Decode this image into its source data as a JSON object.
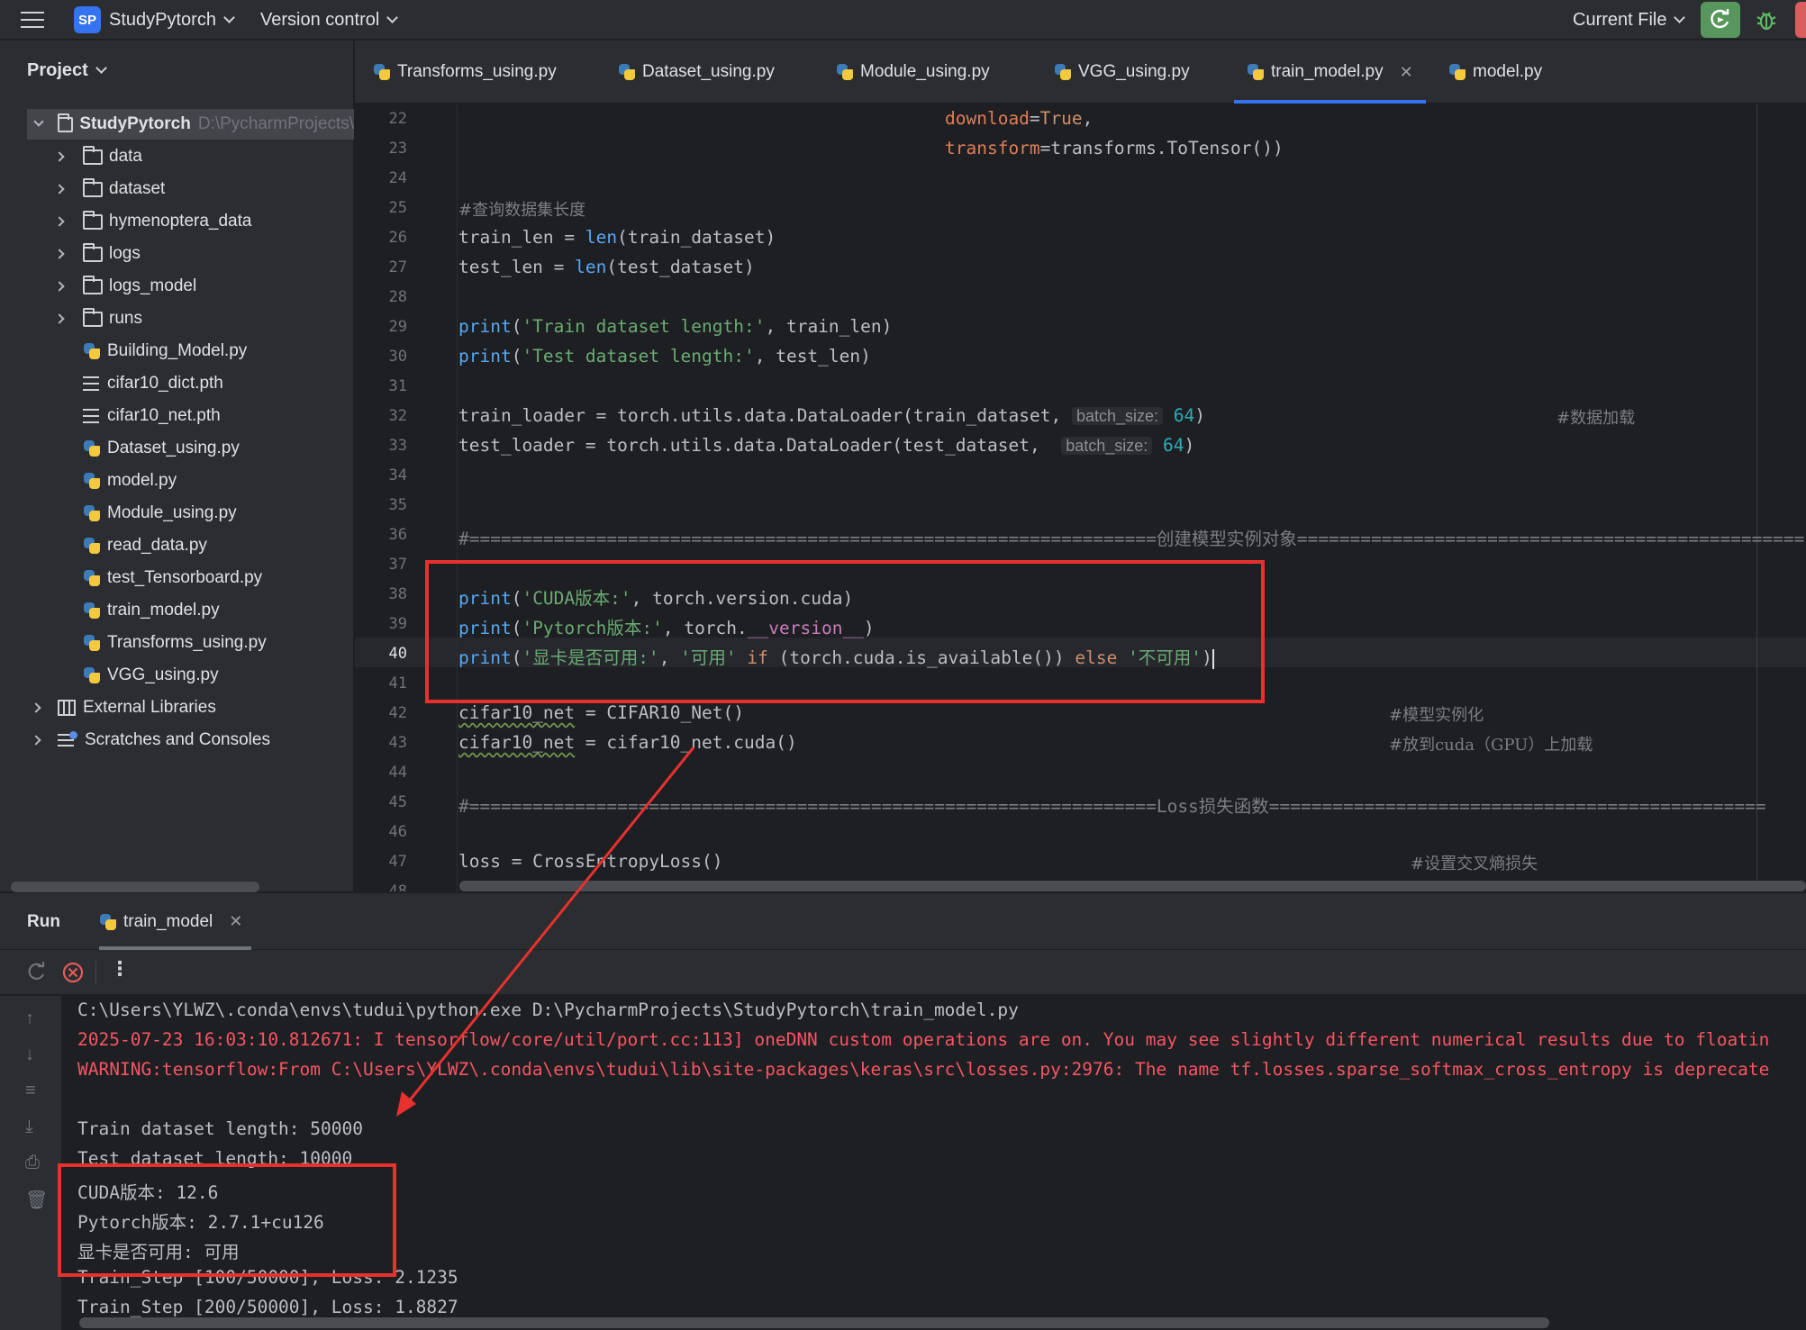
{
  "titlebar": {
    "project_badge": "SP",
    "project_name": "StudyPytorch",
    "vcs": "Version control",
    "run_config": "Current File"
  },
  "sidebar": {
    "header": "Project",
    "root": {
      "name": "StudyPytorch",
      "path": "D:\\PycharmProjects\\"
    },
    "items": [
      {
        "label": "data",
        "kind": "folder"
      },
      {
        "label": "dataset",
        "kind": "folder"
      },
      {
        "label": "hymenoptera_data",
        "kind": "folder"
      },
      {
        "label": "logs",
        "kind": "folder"
      },
      {
        "label": "logs_model",
        "kind": "folder"
      },
      {
        "label": "runs",
        "kind": "folder"
      },
      {
        "label": "Building_Model.py",
        "kind": "python"
      },
      {
        "label": "cifar10_dict.pth",
        "kind": "text"
      },
      {
        "label": "cifar10_net.pth",
        "kind": "text"
      },
      {
        "label": "Dataset_using.py",
        "kind": "python"
      },
      {
        "label": "model.py",
        "kind": "python"
      },
      {
        "label": "Module_using.py",
        "kind": "python"
      },
      {
        "label": "read_data.py",
        "kind": "python"
      },
      {
        "label": "test_Tensorboard.py",
        "kind": "python"
      },
      {
        "label": "train_model.py",
        "kind": "python"
      },
      {
        "label": "Transforms_using.py",
        "kind": "python"
      },
      {
        "label": "VGG_using.py",
        "kind": "python"
      }
    ],
    "external_libraries": "External Libraries",
    "scratches": "Scratches and Consoles"
  },
  "tabs": [
    {
      "label": "Transforms_using.py"
    },
    {
      "label": "Dataset_using.py"
    },
    {
      "label": "Module_using.py"
    },
    {
      "label": "VGG_using.py"
    },
    {
      "label": "train_model.py",
      "active": true
    },
    {
      "label": "model.py"
    }
  ],
  "editor": {
    "line_numbers": [
      "22",
      "23",
      "24",
      "25",
      "26",
      "27",
      "28",
      "29",
      "30",
      "31",
      "32",
      "33",
      "34",
      "35",
      "36",
      "37",
      "38",
      "39",
      "40",
      "41",
      "42",
      "43",
      "44",
      "45",
      "46",
      "47",
      "48"
    ],
    "current_line": "40",
    "code": {
      "l22_param": "download",
      "l22_val": "True",
      "l23_param": "transform",
      "l23_rest": "=transforms.ToTensor())",
      "l25": "#查询数据集长度",
      "l26_a": "train_len = ",
      "l26_fn": "len",
      "l26_b": "(train_dataset)",
      "l27_a": "test_len = ",
      "l27_fn": "len",
      "l27_b": "(test_dataset)",
      "l29_fn": "print",
      "l29_str": "'Train dataset length:'",
      "l29_rest": ", train_len)",
      "l30_fn": "print",
      "l30_str": "'Test dataset length:'",
      "l30_rest": ", test_len)",
      "l32_a": "train_loader = torch.utils.data.DataLoader(train_dataset,",
      "l32_hint": "batch_size:",
      "l32_num": "64",
      "l32_end": ")",
      "l32_cmt": "#数据加载",
      "l33_a": "test_loader = torch.utils.data.DataLoader(test_dataset, ",
      "l33_hint": "batch_size:",
      "l33_num": "64",
      "l33_end": ")",
      "l36": "#=================================================================创建模型实例对象================================================",
      "l38_fn": "print",
      "l38_str": "'CUDA版本:'",
      "l38_rest": ", torch.version.cuda)",
      "l39_fn": "print",
      "l39_str": "'Pytorch版本:'",
      "l39_rest_a": ", torch.",
      "l39_dunder": "__version__",
      "l39_end": ")",
      "l40_fn": "print",
      "l40_str1": "'显卡是否可用:'",
      "l40_c1": ", ",
      "l40_str2": "'可用'",
      "l40_kw1": " if ",
      "l40_mid": "(torch.cuda.is_available()) ",
      "l40_kw2": "else",
      "l40_str3": " '不可用'",
      "l40_end": ")",
      "l42_var": "cifar10_net",
      "l42_rest": " = CIFAR10_Net()",
      "l42_cmt": "#模型实例化",
      "l43_var": "cifar10_net",
      "l43_rest": " = cifar10_net.cuda()",
      "l43_cmt": "#放到cuda（GPU）上加载",
      "l45": "#=================================================================Loss损失函数===============================================",
      "l47": "loss = CrossEntropyLoss()",
      "l47_cmt": "#设置交叉熵损失"
    }
  },
  "run": {
    "title": "Run",
    "tab": "train_model",
    "console": [
      {
        "text": "C:\\Users\\YLWZ\\.conda\\envs\\tudui\\python.exe D:\\PycharmProjects\\StudyPytorch\\train_model.py",
        "err": false
      },
      {
        "text": "2025-07-23 16:03:10.812671: I tensorflow/core/util/port.cc:113] oneDNN custom operations are on. You may see slightly different numerical results due to floatin",
        "err": true
      },
      {
        "text": "WARNING:tensorflow:From C:\\Users\\YLWZ\\.conda\\envs\\tudui\\lib\\site-packages\\keras\\src\\losses.py:2976: The name tf.losses.sparse_softmax_cross_entropy is deprecate",
        "err": true
      },
      {
        "text": "",
        "err": false
      },
      {
        "text": "Train dataset length: 50000",
        "err": false
      },
      {
        "text": "Test dataset length: 10000",
        "err": false
      },
      {
        "text": "CUDA版本: 12.6",
        "err": false
      },
      {
        "text": "Pytorch版本: 2.7.1+cu126",
        "err": false
      },
      {
        "text": "显卡是否可用: 可用",
        "err": false
      },
      {
        "text": "Train_Step [100/50000], Loss: 2.1235",
        "err": false
      },
      {
        "text": "Train_Step [200/50000], Loss: 1.8827",
        "err": false
      }
    ]
  },
  "colors": {
    "annotation_red": "#e8312f",
    "accent_blue": "#3574f0",
    "run_green": "#57965c"
  }
}
